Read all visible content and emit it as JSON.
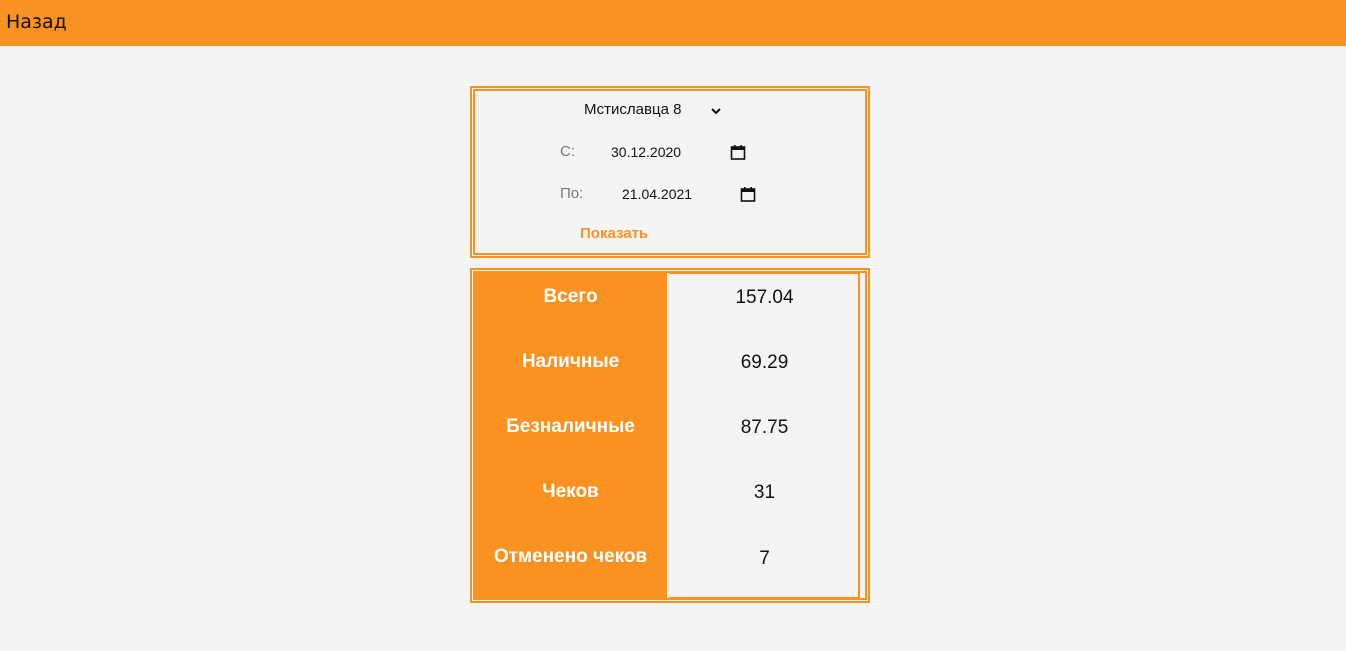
{
  "header": {
    "back_label": "Назад",
    "accent_color": "#f99220"
  },
  "filter": {
    "store_selected": "Мстиславца 8",
    "from_label": "С:",
    "from_value": "30.12.2020",
    "to_label": "По:",
    "to_value": "21.04.2021",
    "show_label": "Показать"
  },
  "stats": {
    "rows": [
      {
        "label": "Всего",
        "value": "157.04"
      },
      {
        "label": "Наличные",
        "value": "69.29"
      },
      {
        "label": "Безналичные",
        "value": "87.75"
      },
      {
        "label": "Чеков",
        "value": "31"
      },
      {
        "label": "Отменено чеков",
        "value": "7"
      }
    ]
  }
}
